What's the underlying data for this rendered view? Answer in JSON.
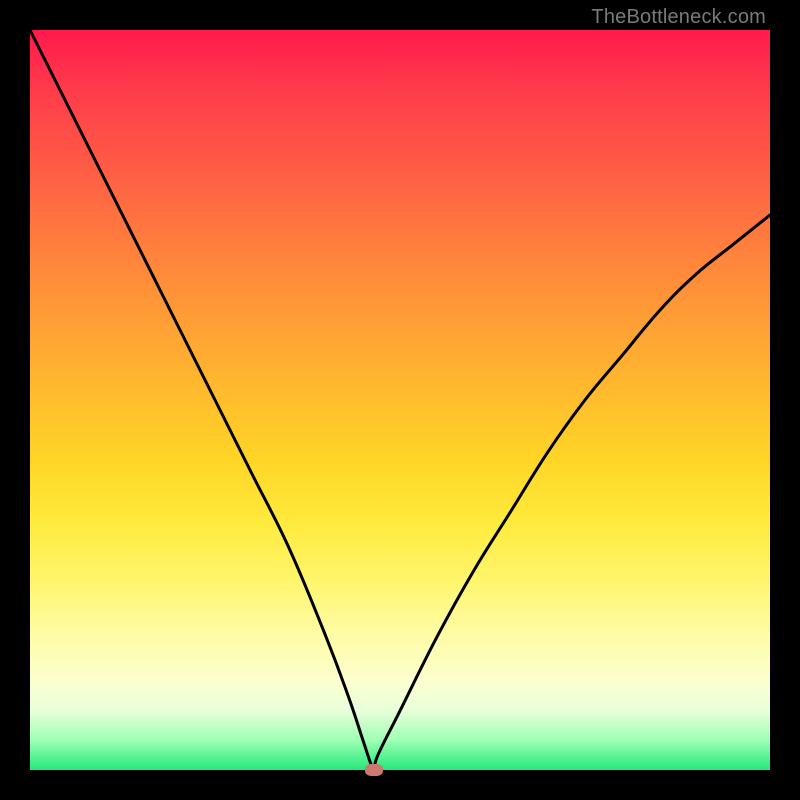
{
  "watermark": "TheBottleneck.com",
  "chart_data": {
    "type": "line",
    "title": "",
    "xlabel": "",
    "ylabel": "",
    "xlim": [
      0,
      100
    ],
    "ylim": [
      0,
      100
    ],
    "grid": false,
    "legend": false,
    "background_gradient": {
      "top": "#ff1a4d",
      "bottom": "#23e97a",
      "note": "red→orange→yellow→green vertical gradient"
    },
    "series": [
      {
        "name": "bottleneck-curve",
        "color": "#000000",
        "x": [
          0,
          5,
          10,
          15,
          20,
          25,
          30,
          35,
          40,
          43,
          45,
          46,
          46.5,
          47,
          50,
          55,
          60,
          65,
          70,
          75,
          80,
          85,
          90,
          95,
          100
        ],
        "y": [
          100,
          90,
          80,
          70,
          60,
          50,
          40,
          30,
          18,
          10,
          4,
          1,
          0,
          2,
          8,
          18,
          27,
          35,
          43,
          50,
          56,
          62,
          67,
          71,
          75
        ]
      }
    ],
    "marker": {
      "name": "optimum-point",
      "x": 46.5,
      "y": 0,
      "color": "#cc7a6e"
    }
  }
}
